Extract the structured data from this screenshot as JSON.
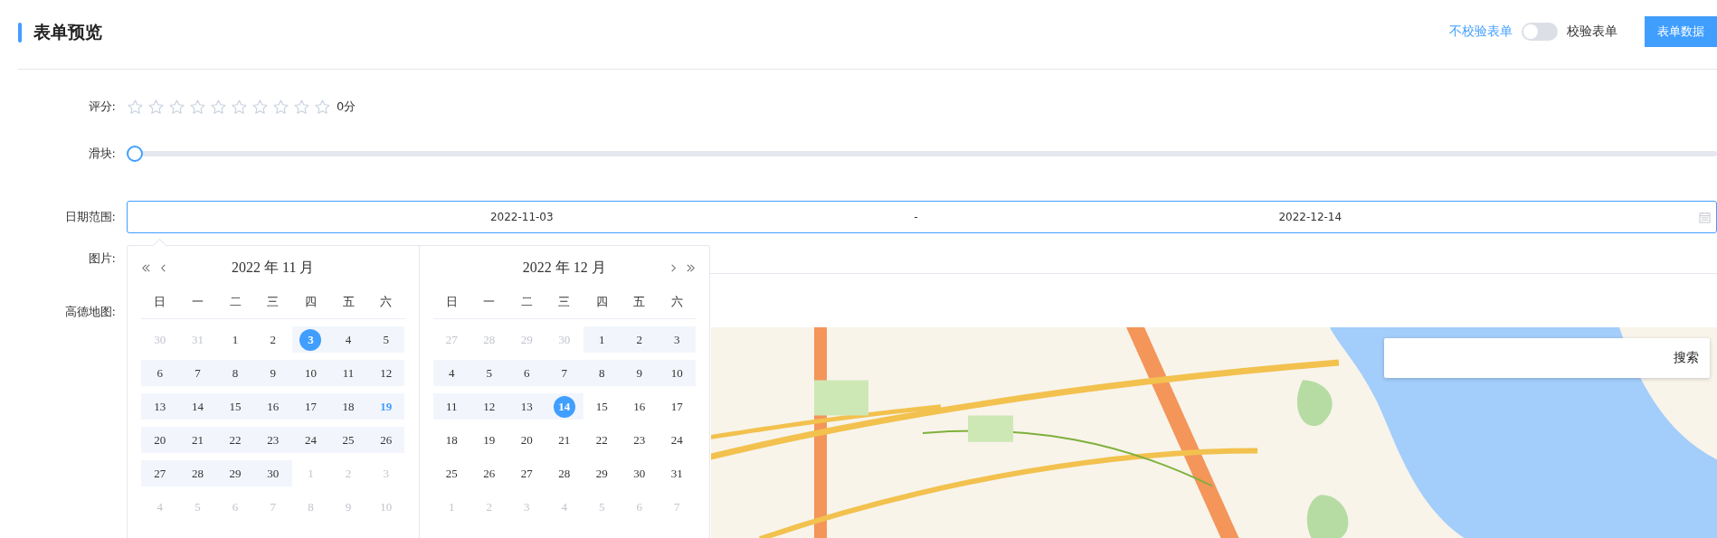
{
  "header": {
    "title": "表单预览",
    "switch": {
      "off_label": "不校验表单",
      "on_label": "校验表单",
      "on": false
    },
    "button": "表单数据"
  },
  "form": {
    "rating": {
      "label": "评分:",
      "stars": 0,
      "score": "0分"
    },
    "slider": {
      "label": "滑块:",
      "level": 0
    },
    "date_range": {
      "label": "日期范围:",
      "start": "2022-11-03",
      "separator": "-",
      "end": "2022-12-14",
      "calendars": [
        {
          "title": "2022 年 11 月",
          "kind": "start",
          "weekdays": [
            "日",
            "一",
            "二",
            "三",
            "四",
            "五",
            "六"
          ],
          "days": [
            {
              "day": "30",
              "kind": "adjacent",
              "in_range": false,
              "selected": false,
              "today": false
            },
            {
              "day": "31",
              "kind": "adjacent",
              "in_range": false,
              "selected": false,
              "today": false
            },
            {
              "day": "1",
              "kind": "current",
              "in_range": false,
              "selected": false,
              "today": false
            },
            {
              "day": "2",
              "kind": "current",
              "in_range": false,
              "selected": false,
              "today": false
            },
            {
              "day": "3",
              "kind": "current",
              "in_range": true,
              "selected": true,
              "today": false
            },
            {
              "day": "4",
              "kind": "current",
              "in_range": true,
              "selected": false,
              "today": false
            },
            {
              "day": "5",
              "kind": "current",
              "in_range": true,
              "selected": false,
              "today": false
            },
            {
              "day": "6",
              "kind": "current",
              "in_range": true,
              "selected": false,
              "today": false
            },
            {
              "day": "7",
              "kind": "current",
              "in_range": true,
              "selected": false,
              "today": false
            },
            {
              "day": "8",
              "kind": "current",
              "in_range": true,
              "selected": false,
              "today": false
            },
            {
              "day": "9",
              "kind": "current",
              "in_range": true,
              "selected": false,
              "today": false
            },
            {
              "day": "10",
              "kind": "current",
              "in_range": true,
              "selected": false,
              "today": false
            },
            {
              "day": "11",
              "kind": "current",
              "in_range": true,
              "selected": false,
              "today": false
            },
            {
              "day": "12",
              "kind": "current",
              "in_range": true,
              "selected": false,
              "today": false
            },
            {
              "day": "13",
              "kind": "current",
              "in_range": true,
              "selected": false,
              "today": false
            },
            {
              "day": "14",
              "kind": "current",
              "in_range": true,
              "selected": false,
              "today": false
            },
            {
              "day": "15",
              "kind": "current",
              "in_range": true,
              "selected": false,
              "today": false
            },
            {
              "day": "16",
              "kind": "current",
              "in_range": true,
              "selected": false,
              "today": false
            },
            {
              "day": "17",
              "kind": "current",
              "in_range": true,
              "selected": false,
              "today": false
            },
            {
              "day": "18",
              "kind": "current",
              "in_range": true,
              "selected": false,
              "today": false
            },
            {
              "day": "19",
              "kind": "current",
              "in_range": true,
              "selected": false,
              "today": true
            },
            {
              "day": "20",
              "kind": "current",
              "in_range": true,
              "selected": false,
              "today": false
            },
            {
              "day": "21",
              "kind": "current",
              "in_range": true,
              "selected": false,
              "today": false
            },
            {
              "day": "22",
              "kind": "current",
              "in_range": true,
              "selected": false,
              "today": false
            },
            {
              "day": "23",
              "kind": "current",
              "in_range": true,
              "selected": false,
              "today": false
            },
            {
              "day": "24",
              "kind": "current",
              "in_range": true,
              "selected": false,
              "today": false
            },
            {
              "day": "25",
              "kind": "current",
              "in_range": true,
              "selected": false,
              "today": false
            },
            {
              "day": "26",
              "kind": "current",
              "in_range": true,
              "selected": false,
              "today": false
            },
            {
              "day": "27",
              "kind": "current",
              "in_range": true,
              "selected": false,
              "today": false
            },
            {
              "day": "28",
              "kind": "current",
              "in_range": true,
              "selected": false,
              "today": false
            },
            {
              "day": "29",
              "kind": "current",
              "in_range": true,
              "selected": false,
              "today": false
            },
            {
              "day": "30",
              "kind": "current",
              "in_range": true,
              "selected": false,
              "today": false
            },
            {
              "day": "1",
              "kind": "adjacent",
              "in_range": false,
              "selected": false,
              "today": false
            },
            {
              "day": "2",
              "kind": "adjacent",
              "in_range": false,
              "selected": false,
              "today": false
            },
            {
              "day": "3",
              "kind": "adjacent",
              "in_range": false,
              "selected": false,
              "today": false
            },
            {
              "day": "4",
              "kind": "adjacent",
              "in_range": false,
              "selected": false,
              "today": false
            },
            {
              "day": "5",
              "kind": "adjacent",
              "in_range": false,
              "selected": false,
              "today": false
            },
            {
              "day": "6",
              "kind": "adjacent",
              "in_range": false,
              "selected": false,
              "today": false
            },
            {
              "day": "7",
              "kind": "adjacent",
              "in_range": false,
              "selected": false,
              "today": false
            },
            {
              "day": "8",
              "kind": "adjacent",
              "in_range": false,
              "selected": false,
              "today": false
            },
            {
              "day": "9",
              "kind": "adjacent",
              "in_range": false,
              "selected": false,
              "today": false
            },
            {
              "day": "10",
              "kind": "adjacent",
              "in_range": false,
              "selected": false,
              "today": false
            }
          ]
        },
        {
          "title": "2022 年 12 月",
          "kind": "end",
          "weekdays": [
            "日",
            "一",
            "二",
            "三",
            "四",
            "五",
            "六"
          ],
          "days": [
            {
              "day": "27",
              "kind": "adjacent",
              "in_range": false,
              "selected": false,
              "today": false
            },
            {
              "day": "28",
              "kind": "adjacent",
              "in_range": false,
              "selected": false,
              "today": false
            },
            {
              "day": "29",
              "kind": "adjacent",
              "in_range": false,
              "selected": false,
              "today": false
            },
            {
              "day": "30",
              "kind": "adjacent",
              "in_range": false,
              "selected": false,
              "today": false
            },
            {
              "day": "1",
              "kind": "current",
              "in_range": true,
              "selected": false,
              "today": false
            },
            {
              "day": "2",
              "kind": "current",
              "in_range": true,
              "selected": false,
              "today": false
            },
            {
              "day": "3",
              "kind": "current",
              "in_range": true,
              "selected": false,
              "today": false
            },
            {
              "day": "4",
              "kind": "current",
              "in_range": true,
              "selected": false,
              "today": false
            },
            {
              "day": "5",
              "kind": "current",
              "in_range": true,
              "selected": false,
              "today": false
            },
            {
              "day": "6",
              "kind": "current",
              "in_range": true,
              "selected": false,
              "today": false
            },
            {
              "day": "7",
              "kind": "current",
              "in_range": true,
              "selected": false,
              "today": false
            },
            {
              "day": "8",
              "kind": "current",
              "in_range": true,
              "selected": false,
              "today": false
            },
            {
              "day": "9",
              "kind": "current",
              "in_range": true,
              "selected": false,
              "today": false
            },
            {
              "day": "10",
              "kind": "current",
              "in_range": true,
              "selected": false,
              "today": false
            },
            {
              "day": "11",
              "kind": "current",
              "in_range": true,
              "selected": false,
              "today": false
            },
            {
              "day": "12",
              "kind": "current",
              "in_range": true,
              "selected": false,
              "today": false
            },
            {
              "day": "13",
              "kind": "current",
              "in_range": true,
              "selected": false,
              "today": false
            },
            {
              "day": "14",
              "kind": "current",
              "in_range": true,
              "selected": true,
              "today": false
            },
            {
              "day": "15",
              "kind": "current",
              "in_range": false,
              "selected": false,
              "today": false
            },
            {
              "day": "16",
              "kind": "current",
              "in_range": false,
              "selected": false,
              "today": false
            },
            {
              "day": "17",
              "kind": "current",
              "in_range": false,
              "selected": false,
              "today": false
            },
            {
              "day": "18",
              "kind": "current",
              "in_range": false,
              "selected": false,
              "today": false
            },
            {
              "day": "19",
              "kind": "current",
              "in_range": false,
              "selected": false,
              "today": false
            },
            {
              "day": "20",
              "kind": "current",
              "in_range": false,
              "selected": false,
              "today": false
            },
            {
              "day": "21",
              "kind": "current",
              "in_range": false,
              "selected": false,
              "today": false
            },
            {
              "day": "22",
              "kind": "current",
              "in_range": false,
              "selected": false,
              "today": false
            },
            {
              "day": "23",
              "kind": "current",
              "in_range": false,
              "selected": false,
              "today": false
            },
            {
              "day": "24",
              "kind": "current",
              "in_range": false,
              "selected": false,
              "today": false
            },
            {
              "day": "25",
              "kind": "current",
              "in_range": false,
              "selected": false,
              "today": false
            },
            {
              "day": "26",
              "kind": "current",
              "in_range": false,
              "selected": false,
              "today": false
            },
            {
              "day": "27",
              "kind": "current",
              "in_range": false,
              "selected": false,
              "today": false
            },
            {
              "day": "28",
              "kind": "current",
              "in_range": false,
              "selected": false,
              "today": false
            },
            {
              "day": "29",
              "kind": "current",
              "in_range": false,
              "selected": false,
              "today": false
            },
            {
              "day": "30",
              "kind": "current",
              "in_range": false,
              "selected": false,
              "today": false
            },
            {
              "day": "31",
              "kind": "current",
              "in_range": false,
              "selected": false,
              "today": false
            },
            {
              "day": "1",
              "kind": "adjacent",
              "in_range": false,
              "selected": false,
              "today": false
            },
            {
              "day": "2",
              "kind": "adjacent",
              "in_range": false,
              "selected": false,
              "today": false
            },
            {
              "day": "3",
              "kind": "adjacent",
              "in_range": false,
              "selected": false,
              "today": false
            },
            {
              "day": "4",
              "kind": "adjacent",
              "in_range": false,
              "selected": false,
              "today": false
            },
            {
              "day": "5",
              "kind": "adjacent",
              "in_range": false,
              "selected": false,
              "today": false
            },
            {
              "day": "6",
              "kind": "adjacent",
              "in_range": false,
              "selected": false,
              "today": false
            },
            {
              "day": "7",
              "kind": "adjacent",
              "in_range": false,
              "selected": false,
              "today": false
            }
          ]
        }
      ]
    },
    "image": {
      "label": "图片:"
    },
    "map": {
      "label": "高德地图:",
      "kind": "picture",
      "search_button": "搜索"
    }
  }
}
